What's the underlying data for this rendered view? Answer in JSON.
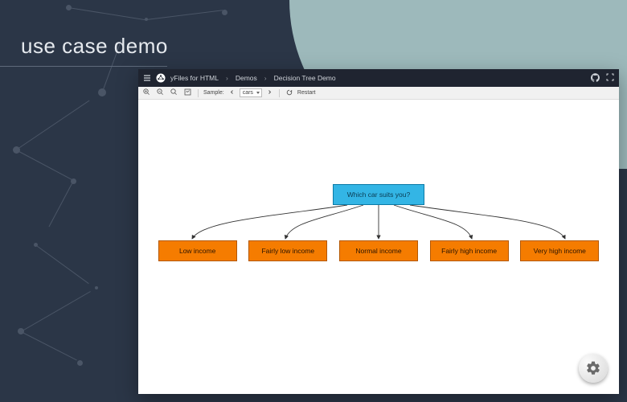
{
  "page": {
    "headline": "use case demo"
  },
  "titlebar": {
    "product": "yFiles for HTML",
    "crumb1": "Demos",
    "crumb2": "Decision Tree Demo"
  },
  "toolbar": {
    "sample_label": "Sample:",
    "sample_value": "cars",
    "restart_label": "Restart"
  },
  "diagram": {
    "root": "Which car suits you?",
    "children": [
      "Low income",
      "Fairly low income",
      "Normal income",
      "Fairly high income",
      "Very high income"
    ]
  },
  "colors": {
    "root_fill": "#33b5e5",
    "child_fill": "#f57c00",
    "bg_dark": "#2b3647",
    "bg_teal": "#9db9bb"
  }
}
